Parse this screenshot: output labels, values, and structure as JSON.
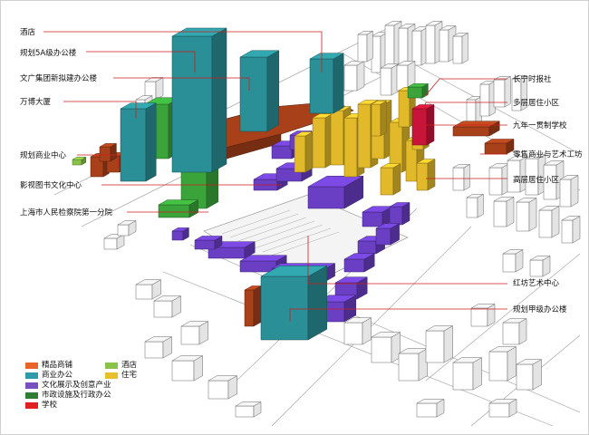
{
  "labels": {
    "hotel": "酒店",
    "planned_5a_office": "规划5A级办公楼",
    "wenguang_office": "文广集团新拟建办公楼",
    "wanbo": "万博大厦",
    "planned_commercial": "规划商业中心",
    "film_book_center": "影视图书文化中心",
    "procuratorate": "上海市人民检察院第一分院",
    "changning_times": "长宁时报社",
    "multistory_residential": "多层居住小区",
    "nine_year_school": "九年一贯制学校",
    "retail_art_workshop": "零售商业与艺术工坊",
    "highrise_residential": "高层居住小区",
    "red_workshop_art_center": "红坊艺术中心",
    "planned_grade_a_office": "规划甲级办公楼"
  },
  "legend": [
    {
      "label": "精品商铺",
      "color": "#e8642a"
    },
    {
      "label": "酒店",
      "color": "#8bc34a"
    },
    {
      "label": "商业办公",
      "color": "#2f9aa8"
    },
    {
      "label": "住宅",
      "color": "#e6c02a"
    },
    {
      "label": "文化展示及创意产业",
      "color": "#7a4fc0"
    },
    {
      "label": "市政设施及行政办公",
      "color": "#2e7d32"
    },
    {
      "label": "学校",
      "color": "#e02020"
    }
  ],
  "colors": {
    "leader_line": "#cc1f1f",
    "teal": "#2a8f96",
    "green": "#3aa43a",
    "purple": "#6a3fc4",
    "yellow": "#e2b92a",
    "brown": "#a8401a",
    "crimson": "#c8143a",
    "grey_outline": "#555555"
  }
}
